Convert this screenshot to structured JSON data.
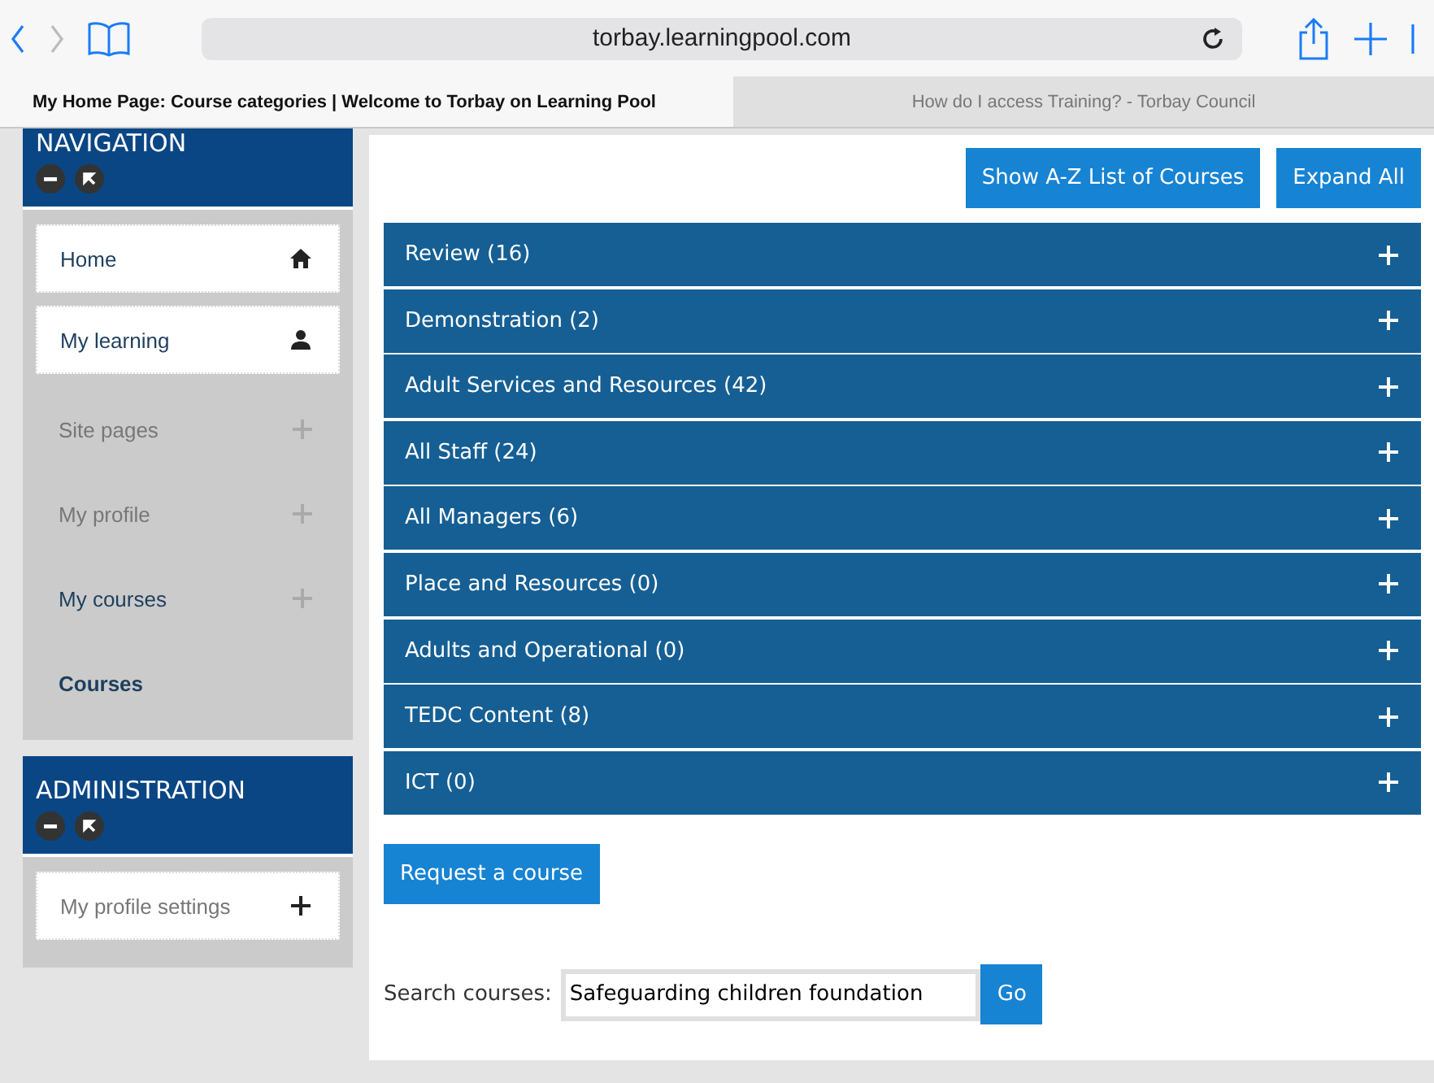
{
  "browser": {
    "address": "torbay.learningpool.com"
  },
  "tabs": [
    {
      "label": "My Home Page: Course categories | Welcome to Torbay on Learning Pool",
      "selected": true
    },
    {
      "label": "How do I access Training? - Torbay Council",
      "selected": false
    }
  ],
  "navigation": {
    "title": "NAVIGATION",
    "items": [
      {
        "label": "Home",
        "kind": "box",
        "muted": false
      },
      {
        "label": "My learning",
        "kind": "box",
        "muted": false
      },
      {
        "label": "Site pages",
        "kind": "branch",
        "muted": true
      },
      {
        "label": "My profile",
        "kind": "branch",
        "muted": true
      },
      {
        "label": "My courses",
        "kind": "branch",
        "muted": false
      },
      {
        "label": "Courses",
        "kind": "leaf",
        "muted": false
      }
    ]
  },
  "administration": {
    "title": "ADMINISTRATION",
    "items": [
      {
        "label": "My profile settings",
        "kind": "box",
        "muted": true
      }
    ]
  },
  "actions": [
    "Show A-Z List of Courses",
    "Expand All"
  ],
  "categories": [
    {
      "label": "Review (16)",
      "expanded": false
    },
    {
      "label": "Demonstration (2)",
      "expanded": false
    },
    {
      "label": "Adult Services and Resources (42)",
      "expanded": false
    },
    {
      "label": "All Staff (24)",
      "expanded": false
    },
    {
      "label": "All Managers (6)",
      "expanded": false
    },
    {
      "label": "Place and Resources (0)",
      "expanded": false
    },
    {
      "label": "Adults and Operational (0)",
      "expanded": false
    },
    {
      "label": "TEDC Content (8)",
      "expanded": false
    },
    {
      "label": "ICT (0)",
      "expanded": false
    }
  ],
  "request_button": "Request a course",
  "search": {
    "label": "Search courses:",
    "value": "Safeguarding children foundation",
    "button": "Go"
  }
}
